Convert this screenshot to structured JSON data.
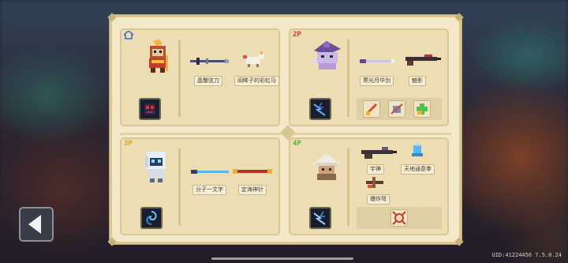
{
  "players": [
    {
      "tag": "",
      "tag_color": "#3c6fd1",
      "weapons": [
        "晶蟹弦刀",
        "阎眸子的彩虹马"
      ],
      "skill_icon": "dark-skull-skill",
      "portrait": "monkey-king-hero"
    },
    {
      "tag": "2P",
      "tag_color": "#d83b3b",
      "weapons": [
        "寒光月华剑",
        "魅影"
      ],
      "skill_icon": "lightning-skill",
      "portrait": "witch-hat-hero",
      "buffs": [
        "sword-buff-icon",
        "armor-buff-icon",
        "heal-buff-icon"
      ]
    },
    {
      "tag": "3P",
      "tag_color": "#e7a11e",
      "weapons": [
        "分子一文字",
        "定海神针"
      ],
      "skill_icon": "vortex-skill",
      "portrait": "robot-hood-hero"
    },
    {
      "tag": "4P",
      "tag_color": "#5fb33a",
      "weapons": [
        "宇神",
        "天地通意拳",
        "爆炸弩"
      ],
      "skill_icon": "lightning-skill",
      "portrait": "mushroom-hat-hero",
      "buffs": [
        "shield-burst-buff-icon"
      ]
    }
  ],
  "uid_text": "UID:41224456  7.5.0.24",
  "back_label": "back"
}
